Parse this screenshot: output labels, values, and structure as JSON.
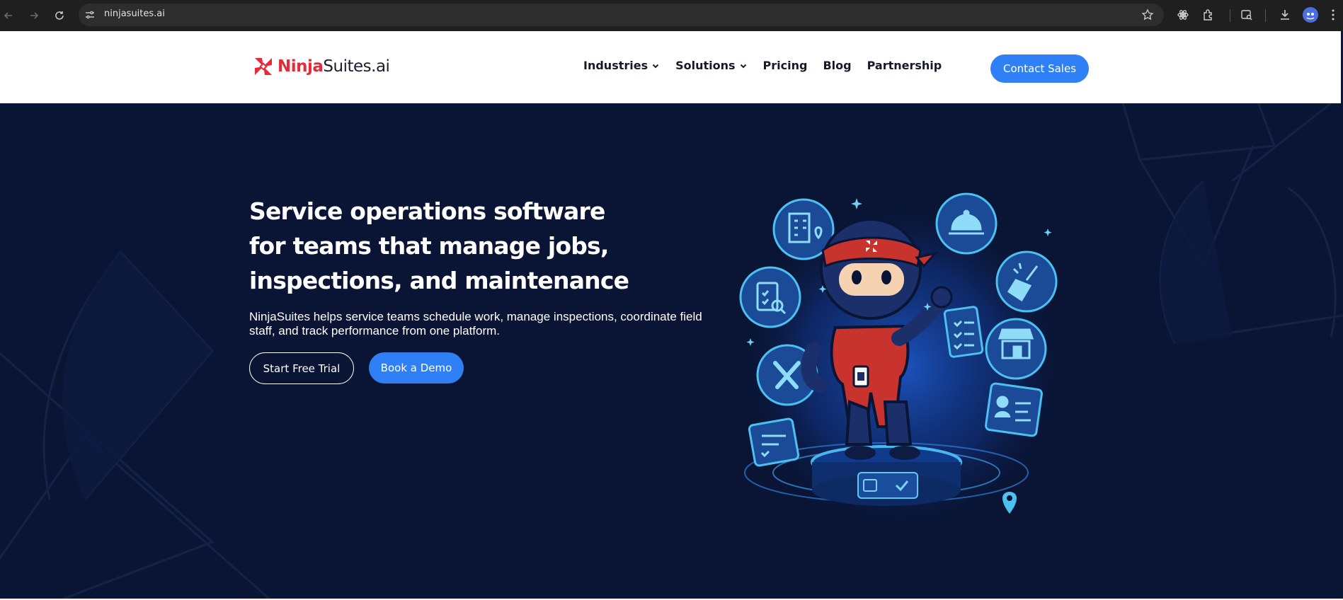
{
  "browser": {
    "url": "ninjasuites.ai"
  },
  "header": {
    "logo": {
      "brand_primary": "Ninja",
      "brand_secondary": "Suites.ai"
    },
    "nav": [
      {
        "label": "Industries",
        "has_dropdown": true
      },
      {
        "label": "Solutions",
        "has_dropdown": true
      },
      {
        "label": "Pricing",
        "has_dropdown": false
      },
      {
        "label": "Blog",
        "has_dropdown": false
      },
      {
        "label": "Partnership",
        "has_dropdown": false
      }
    ],
    "contact_label": "Contact Sales"
  },
  "hero": {
    "title": "Service operations software for teams that manage jobs, inspections, and maintenance",
    "subtitle": "NinjaSuites helps service teams schedule work, manage inspections, coordinate field staff, and track performance from one platform.",
    "primary_cta": "Start Free Trial",
    "secondary_cta": "Book a Demo"
  },
  "colors": {
    "accent": "#2f80f5",
    "brand_red": "#e8293a",
    "hero_bg": "#0a1535",
    "icon_glow": "#38b7e8"
  },
  "icons": [
    "back-arrow-icon",
    "forward-arrow-icon",
    "reload-icon",
    "site-settings-icon",
    "bookmark-star-icon",
    "extension-icon",
    "puzzle-icon",
    "reading-mode-icon",
    "download-icon",
    "profile-avatar-icon",
    "menu-kebab-icon",
    "logo-pinwheel-icon",
    "chevron-down-icon"
  ]
}
